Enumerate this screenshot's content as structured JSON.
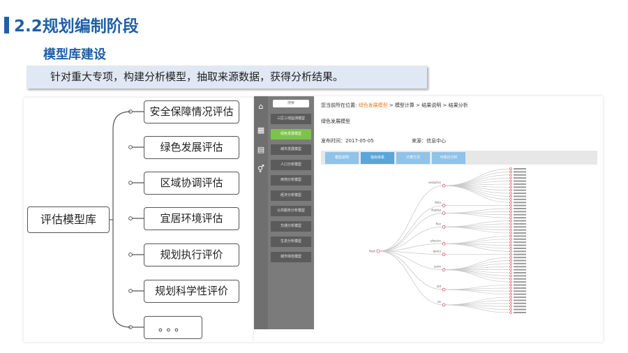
{
  "header": {
    "title": "2.2规划编制阶段",
    "subtitle": "模型库建设",
    "banner": "针对重大专项，构建分析模型，抽取来源数据，获得分析结果。"
  },
  "mindmap": {
    "root": "评估模型库",
    "nodes": [
      "安全保障情况评估",
      "绿色发展评估",
      "区域协调评估",
      "宜居环境评估",
      "规划执行评价",
      "规划科学性评价",
      "。。。"
    ]
  },
  "app": {
    "sidebar_icons": [
      "home-icon",
      "grid-icon",
      "document-icon",
      "gender-icon"
    ],
    "search_placeholder": "搜索",
    "menu": [
      "三区三线监测模型",
      "绿色发展模型",
      "城市发展模型",
      "人口分析模型",
      "用地分析模型",
      "经济分析模型",
      "公共服务分析模型",
      "交通分析模型",
      "生态分析模型",
      "城市体检模型"
    ],
    "active_menu_index": 1,
    "breadcrumb": {
      "prefix": "您当前所在位置:",
      "items": [
        "绿色发展模型",
        "模型计算",
        "结果说明",
        "结果分析"
      ],
      "separator": ">"
    },
    "model_title": "绿色发展模型",
    "publish_label": "发布时间：",
    "publish_date": "2017-05-05",
    "source_label": "来源：",
    "source": "信息中心",
    "tabs": [
      "模型说明",
      "指标体系",
      "计算方式",
      "可视化分析"
    ],
    "active_tab_index": 1,
    "tree": {
      "root": "Root",
      "groups": [
        {
          "label": "analytics",
          "leaves": 12
        },
        {
          "label": "data",
          "leaves": 1
        },
        {
          "label": "display",
          "leaves": 4
        },
        {
          "label": "flex",
          "leaves": 5
        },
        {
          "label": "physics",
          "leaves": 6
        },
        {
          "label": "query",
          "leaves": 1
        },
        {
          "label": "scale",
          "leaves": 9
        },
        {
          "label": "util",
          "leaves": 4
        },
        {
          "label": "vis",
          "leaves": 6
        }
      ]
    }
  }
}
